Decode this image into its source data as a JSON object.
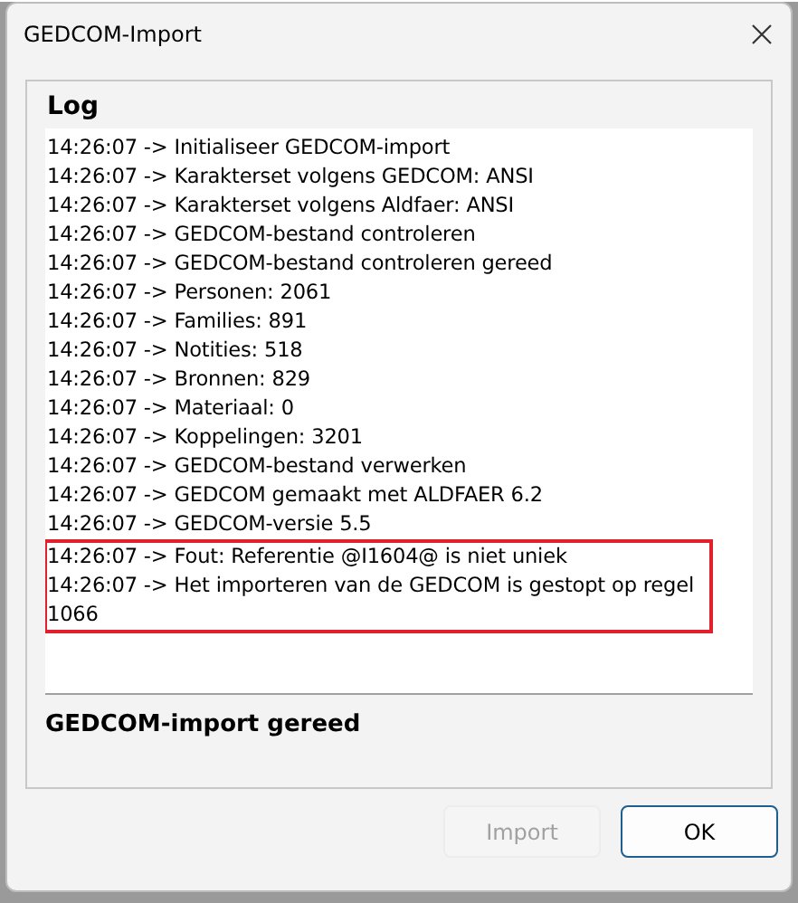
{
  "window": {
    "title": "GEDCOM-Import"
  },
  "log": {
    "title": "Log",
    "lines": [
      {
        "text": "14:26:07 -> Initialiseer GEDCOM-import",
        "highlighted": false
      },
      {
        "text": "14:26:07 -> Karakterset volgens GEDCOM: ANSI",
        "highlighted": false
      },
      {
        "text": "14:26:07 -> Karakterset volgens Aldfaer: ANSI",
        "highlighted": false
      },
      {
        "text": "14:26:07 -> GEDCOM-bestand controleren",
        "highlighted": false
      },
      {
        "text": "14:26:07 -> GEDCOM-bestand controleren gereed",
        "highlighted": false
      },
      {
        "text": "14:26:07 -> Personen: 2061",
        "highlighted": false
      },
      {
        "text": "14:26:07 -> Families: 891",
        "highlighted": false
      },
      {
        "text": "14:26:07 -> Notities: 518",
        "highlighted": false
      },
      {
        "text": "14:26:07 -> Bronnen: 829",
        "highlighted": false
      },
      {
        "text": "14:26:07 -> Materiaal: 0",
        "highlighted": false
      },
      {
        "text": "14:26:07 -> Koppelingen: 3201",
        "highlighted": false
      },
      {
        "text": "14:26:07 -> GEDCOM-bestand verwerken",
        "highlighted": false
      },
      {
        "text": "14:26:07 -> GEDCOM gemaakt met ALDFAER 6.2",
        "highlighted": false
      },
      {
        "text": "14:26:07 -> GEDCOM-versie 5.5",
        "highlighted": false
      },
      {
        "text": "14:26:07 -> Fout: Referentie @I1604@ is niet uniek",
        "highlighted": true
      },
      {
        "text": "14:26:07 -> Het importeren van de GEDCOM is gestopt op regel 1066",
        "highlighted": true
      }
    ]
  },
  "status": "GEDCOM-import gereed",
  "buttons": [
    {
      "label": "Import",
      "disabled": true
    },
    {
      "label": "OK",
      "disabled": false
    }
  ]
}
